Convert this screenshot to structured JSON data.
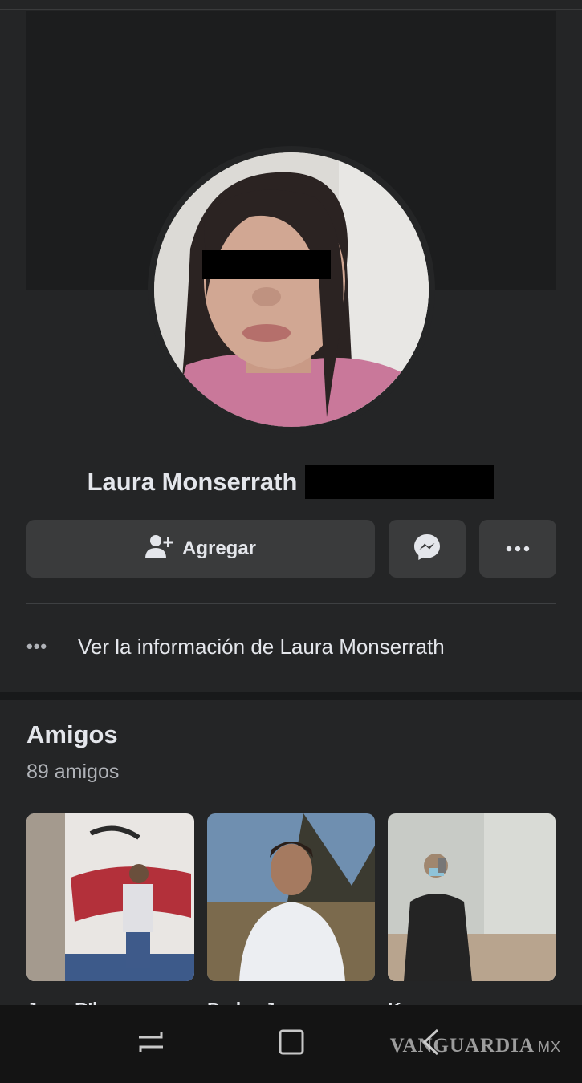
{
  "profile": {
    "name": "Laura Monserrath"
  },
  "actions": {
    "add_label": "Agregar"
  },
  "info": {
    "dots": "•••",
    "label": "Ver la información de Laura Monserrath"
  },
  "friends": {
    "title": "Amigos",
    "count": "89 amigos",
    "items": [
      {
        "name": "Juan R'h"
      },
      {
        "name": "Pedro Juarez"
      },
      {
        "name": "Kano"
      }
    ]
  },
  "watermark": {
    "brand": "VANGUARDIA",
    "suffix": "MX"
  },
  "colors": {
    "background": "#242526",
    "button": "#3a3b3c",
    "text": "#e4e6eb",
    "secondary_text": "#b0b3b8"
  },
  "icons": [
    "add-friend-icon",
    "messenger-icon",
    "more-icon",
    "recents-icon",
    "home-icon",
    "back-icon"
  ]
}
